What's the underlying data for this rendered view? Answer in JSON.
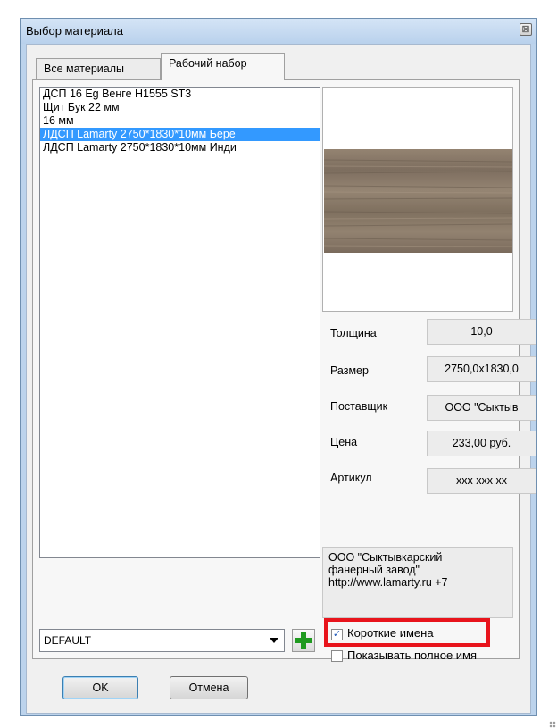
{
  "window": {
    "title": "Выбор материала",
    "close_symbol": "⊠"
  },
  "tabs": [
    {
      "label": "Все материалы",
      "active": false
    },
    {
      "label": "Рабочий набор",
      "active": true
    }
  ],
  "materials": [
    {
      "name": "ДСП 16 Eg Венге H1555 ST3",
      "selected": false
    },
    {
      "name": "Щит Бук 22 мм",
      "selected": false
    },
    {
      "name": "16 мм",
      "selected": false
    },
    {
      "name": "ЛДСП Lamarty 2750*1830*10мм Бере",
      "selected": true
    },
    {
      "name": "ЛДСП Lamarty 2750*1830*10мм Инди",
      "selected": false
    }
  ],
  "properties": {
    "thickness": {
      "label": "Толщина",
      "value": "10,0"
    },
    "size": {
      "label": "Размер",
      "value": "2750,0x1830,0"
    },
    "supplier": {
      "label": "Поставщик",
      "value": "ООО \"Сыктыв"
    },
    "price": {
      "label": "Цена",
      "value": "233,00 руб."
    },
    "article": {
      "label": "Артикул",
      "value": "xxx xxx xx"
    }
  },
  "supplier_info": {
    "line1": "ООО \"Сыктывкарский",
    "line2": "фанерный завод\"",
    "line3": "http://www.lamarty.ru  +7"
  },
  "set_combo": {
    "value": "DEFAULT"
  },
  "options": {
    "short_names": {
      "label": "Короткие имена",
      "checked": true
    },
    "show_full_name": {
      "label": "Показывать полное имя",
      "checked": false
    }
  },
  "buttons": {
    "ok": "OK",
    "cancel": "Отмена"
  },
  "colors": {
    "selection": "#3399ff",
    "highlight_frame": "#e8141c",
    "add_icon": "#1f9a1f",
    "wood_texture": "#8b7b6a"
  }
}
